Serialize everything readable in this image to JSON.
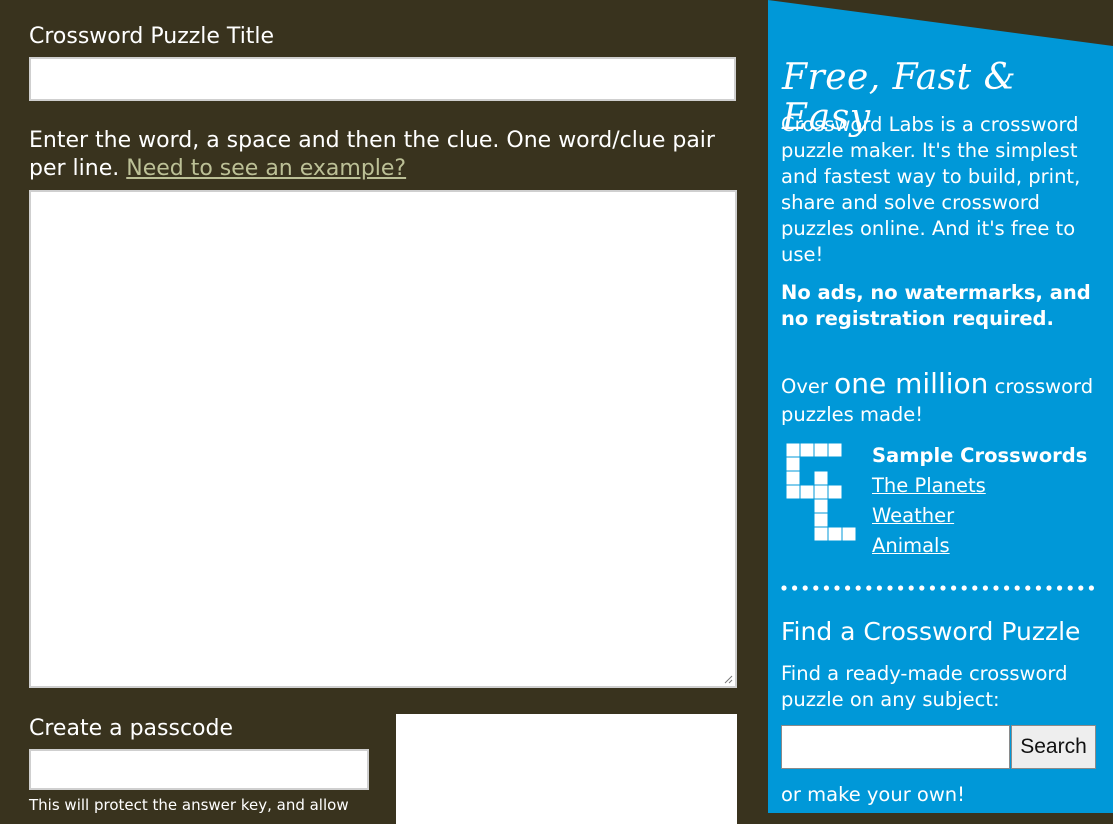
{
  "form": {
    "title_label": "Crossword Puzzle Title",
    "instructions_text": "Enter the word, a space and then the clue. One word/clue pair per line.",
    "example_link": "Need to see an example?",
    "passcode_label": "Create a passcode",
    "passcode_help": "This will protect the answer key, and allow"
  },
  "sidebar": {
    "tagline": "Free, Fast & Easy",
    "about": "Crossword Labs is a crossword puzzle maker. It's the simplest and fastest way to build, print, share and solve crossword puzzles online. And it's free to use!",
    "about_bold": "No ads, no watermarks, and no registration required.",
    "over_prefix": "Over",
    "over_big": "one million",
    "over_suffix": "crossword puzzles made!",
    "samples_heading": "Sample Crosswords",
    "samples": [
      "The Planets",
      "Weather",
      "Animals"
    ],
    "find_heading": "Find a Crossword Puzzle",
    "find_desc": "Find a ready-made crossword puzzle on any subject:",
    "search_button": "Search",
    "make_own": "or make your own!"
  },
  "colors": {
    "page_bg": "#39331e",
    "sidebar_bg": "#0098d8",
    "link_muted": "#bcc096"
  }
}
